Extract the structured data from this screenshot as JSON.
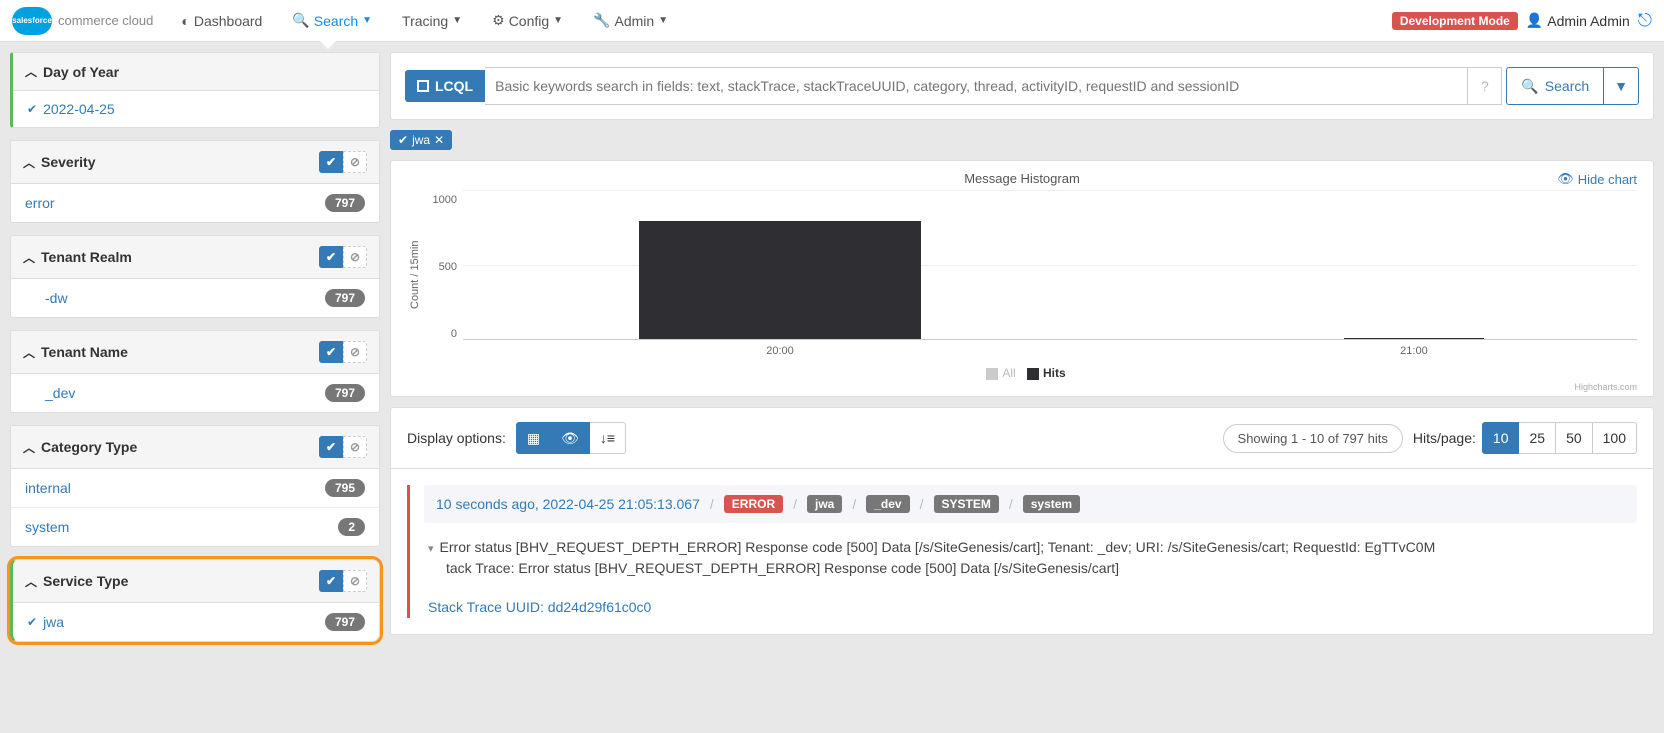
{
  "nav": {
    "brand": "commerce cloud",
    "items": [
      {
        "label": "Dashboard"
      },
      {
        "label": "Search",
        "active": true
      },
      {
        "label": "Tracing"
      },
      {
        "label": "Config"
      },
      {
        "label": "Admin"
      }
    ],
    "dev_badge": "Development Mode",
    "user": "Admin Admin"
  },
  "facets": {
    "day_of_year": {
      "title": "Day of Year",
      "items": [
        {
          "label": "2022-04-25",
          "checked": true
        }
      ]
    },
    "severity": {
      "title": "Severity",
      "items": [
        {
          "label": "error",
          "count": "797"
        }
      ]
    },
    "tenant_realm": {
      "title": "Tenant Realm",
      "items": [
        {
          "label": "-dw",
          "count": "797",
          "indent": true
        }
      ]
    },
    "tenant_name": {
      "title": "Tenant Name",
      "items": [
        {
          "label": "_dev",
          "count": "797",
          "indent": true
        }
      ]
    },
    "category_type": {
      "title": "Category Type",
      "items": [
        {
          "label": "internal",
          "count": "795"
        },
        {
          "label": "system",
          "count": "2"
        }
      ]
    },
    "service_type": {
      "title": "Service Type",
      "items": [
        {
          "label": "jwa",
          "count": "797",
          "checked": true
        }
      ]
    }
  },
  "search": {
    "lcql_label": "LCQL",
    "placeholder": "Basic keywords search in fields: text, stackTrace, stackTraceUUID, category, thread, activityID, requestID and sessionID",
    "button": "Search",
    "tags": [
      {
        "label": "jwa"
      }
    ]
  },
  "chart_data": {
    "type": "bar",
    "title": "Message Histogram",
    "ylabel": "Count / 15min",
    "y_ticks": [
      0,
      500,
      1000
    ],
    "x_ticks": [
      "20:00",
      "21:00"
    ],
    "categories": [
      "20:00",
      "20:15",
      "21:00"
    ],
    "series": [
      {
        "name": "All",
        "color": "#cccccc",
        "values": [
          0,
          0,
          0
        ]
      },
      {
        "name": "Hits",
        "color": "#2e2e33",
        "values": [
          790,
          790,
          7
        ]
      }
    ],
    "hide_label": "Hide chart",
    "credit": "Highcharts.com"
  },
  "results": {
    "display_label": "Display options:",
    "showing": "Showing 1 - 10 of 797 hits",
    "hitspage_label": "Hits/page:",
    "hitspage_opts": [
      "10",
      "25",
      "50",
      "100"
    ],
    "hitspage_active": "10",
    "items": [
      {
        "timestamp": "10 seconds ago, 2022-04-25 21:05:13.067",
        "level": "ERROR",
        "tags": [
          "jwa",
          "_dev",
          "SYSTEM",
          "system"
        ],
        "line1": "Error status [BHV_REQUEST_DEPTH_ERROR] Response code [500] Data [/s/SiteGenesis/cart]; Tenant:        _dev; URI: /s/SiteGenesis/cart; RequestId: EgTTvC0M",
        "line2": "tack Trace: Error status [BHV_REQUEST_DEPTH_ERROR] Response code [500] Data [/s/SiteGenesis/cart]",
        "uuid_label": "Stack Trace UUID: dd24d29f61c0c0"
      }
    ]
  },
  "callout": "1"
}
